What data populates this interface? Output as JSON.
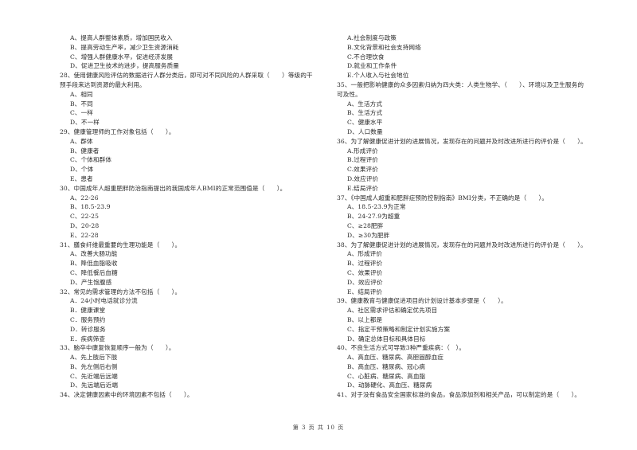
{
  "left_column": [
    {
      "type": "option",
      "text": "A、提高人群整体素质，增加国民收入"
    },
    {
      "type": "option",
      "text": "B、提高劳动生产率，减少卫生资源消耗"
    },
    {
      "type": "option",
      "text": "C、增强人群健康水平，促进经济发展"
    },
    {
      "type": "option",
      "text": "D、促进卫生技术的进步，提高服务质量"
    },
    {
      "type": "question",
      "text": "28、使用健康风险评估的数据进行人群分类后，即可对不同风险的人群采取（　　）等级的干"
    },
    {
      "type": "question",
      "text": "预手段来达到资源的最大利用。"
    },
    {
      "type": "option",
      "text": "A、相同"
    },
    {
      "type": "option",
      "text": "B、不同"
    },
    {
      "type": "option",
      "text": "C、一样"
    },
    {
      "type": "option",
      "text": "D、不一样"
    },
    {
      "type": "question",
      "text": "29、健康管理师的工作对象包括（　　）。"
    },
    {
      "type": "option",
      "text": "A、群体"
    },
    {
      "type": "option",
      "text": "B、健康者"
    },
    {
      "type": "option",
      "text": "C、个体和群体"
    },
    {
      "type": "option",
      "text": "D、个体"
    },
    {
      "type": "option",
      "text": "E、患者"
    },
    {
      "type": "question",
      "text": "30、中国成年人超重肥胖防治指南提出的我国成年人BMI的正常范围值是（　　）。"
    },
    {
      "type": "option",
      "text": "A、22-26"
    },
    {
      "type": "option",
      "text": "B、18.5-23.9"
    },
    {
      "type": "option",
      "text": "C、22-25"
    },
    {
      "type": "option",
      "text": "D、20-28"
    },
    {
      "type": "option",
      "text": "E、22-28"
    },
    {
      "type": "question",
      "text": "31、膳食纤维最重要的生理功能是（　　）。"
    },
    {
      "type": "option",
      "text": "A、改善大肠功能"
    },
    {
      "type": "option",
      "text": "B、降低血脂吸收"
    },
    {
      "type": "option",
      "text": "C、降低餐后血糖"
    },
    {
      "type": "option",
      "text": "D、产生饱腹感"
    },
    {
      "type": "question",
      "text": "32、常见的需求管理的方法不包括（　　）。"
    },
    {
      "type": "option",
      "text": "A．24小时电话就诊分流"
    },
    {
      "type": "option",
      "text": "B．健康课堂"
    },
    {
      "type": "option",
      "text": "C．服务预约"
    },
    {
      "type": "option",
      "text": "D．转诊服务"
    },
    {
      "type": "option",
      "text": "E．疾病筛查"
    },
    {
      "type": "question",
      "text": "33、脑卒中康复恢复顺序一般为（　　）。"
    },
    {
      "type": "option",
      "text": "A、先上肢后下肢"
    },
    {
      "type": "option",
      "text": "B、先左侧后右侧"
    },
    {
      "type": "option",
      "text": "C、先近端后远端"
    },
    {
      "type": "option",
      "text": "D、先远端后近端"
    },
    {
      "type": "question",
      "text": "34、决定健康因素中的环境因素不包括（　　）。"
    }
  ],
  "right_column": [
    {
      "type": "option",
      "text": "A.社会制度与政策"
    },
    {
      "type": "option",
      "text": "B.文化背景和社会支持网络"
    },
    {
      "type": "option",
      "text": "C.不合理饮食"
    },
    {
      "type": "option",
      "text": "D.就业和工作条件"
    },
    {
      "type": "option",
      "text": "E.个人收入与社会地位"
    },
    {
      "type": "question",
      "text": "35、一般把影响健康的众多因素归纳为四大类：人类生物学、（　　）、环境以及卫生服务的"
    },
    {
      "type": "question",
      "text": "可及性。"
    },
    {
      "type": "option",
      "text": "A、生活方式"
    },
    {
      "type": "option",
      "text": "B、生活方式"
    },
    {
      "type": "option",
      "text": "C、健康水平"
    },
    {
      "type": "option",
      "text": "D、人口数量"
    },
    {
      "type": "question",
      "text": "36、为了解健康促进计划的进展情况，发现存在的问题并及时改进所进行的评价是（　　）。"
    },
    {
      "type": "option",
      "text": "A.形成评价"
    },
    {
      "type": "option",
      "text": "B.过程评价"
    },
    {
      "type": "option",
      "text": "C.效果评价"
    },
    {
      "type": "option",
      "text": "D.效应评价"
    },
    {
      "type": "option",
      "text": "E.结局评价"
    },
    {
      "type": "question",
      "text": "37、《中国成人超重和肥胖症预防控制指南》BMI分类，不正确的是（　　）。"
    },
    {
      "type": "option",
      "text": "A、18.5-23.9为正常"
    },
    {
      "type": "option",
      "text": "B、24-27.9为超重"
    },
    {
      "type": "option",
      "text": "C、≥28肥胖"
    },
    {
      "type": "option",
      "text": "D、≥30为肥胖"
    },
    {
      "type": "question",
      "text": "38、为了解健康促进计划的进展情况，发现存在的问题并及时改进所进行的评价是（　　）。"
    },
    {
      "type": "option",
      "text": "A、形成评价"
    },
    {
      "type": "option",
      "text": "B、过程评价"
    },
    {
      "type": "option",
      "text": "C、效果评价"
    },
    {
      "type": "option",
      "text": "D、效应评价"
    },
    {
      "type": "option",
      "text": "E、结局评价"
    },
    {
      "type": "question",
      "text": "39、健康教育与健康促进项目的计划设计基本步骤是（　　）。"
    },
    {
      "type": "option",
      "text": "A、社区需求评估和确定优先项目"
    },
    {
      "type": "option",
      "text": "B、以上都是"
    },
    {
      "type": "option",
      "text": "C、指定干预策略和制定计划实施方案"
    },
    {
      "type": "option",
      "text": "D、确定总体目标和具体目标"
    },
    {
      "type": "question",
      "text": "40、不良生活方式可导致3种严重疾病：（　）。"
    },
    {
      "type": "option",
      "text": "A、高血压、糖尿病、高胆固醇血症"
    },
    {
      "type": "option",
      "text": "B、高血压、糖尿病、冠心病"
    },
    {
      "type": "option",
      "text": "C、心脏病、糖尿病、高血脂"
    },
    {
      "type": "option",
      "text": "D、动脉硬化、高血压、糖尿病"
    },
    {
      "type": "question",
      "text": "41、对于没有食品安全国家标准的食品，食品添加剂和相关产品，可以制定的是（　　）。"
    }
  ],
  "footer": {
    "page_indicator": "第 3 页 共 10 页"
  }
}
